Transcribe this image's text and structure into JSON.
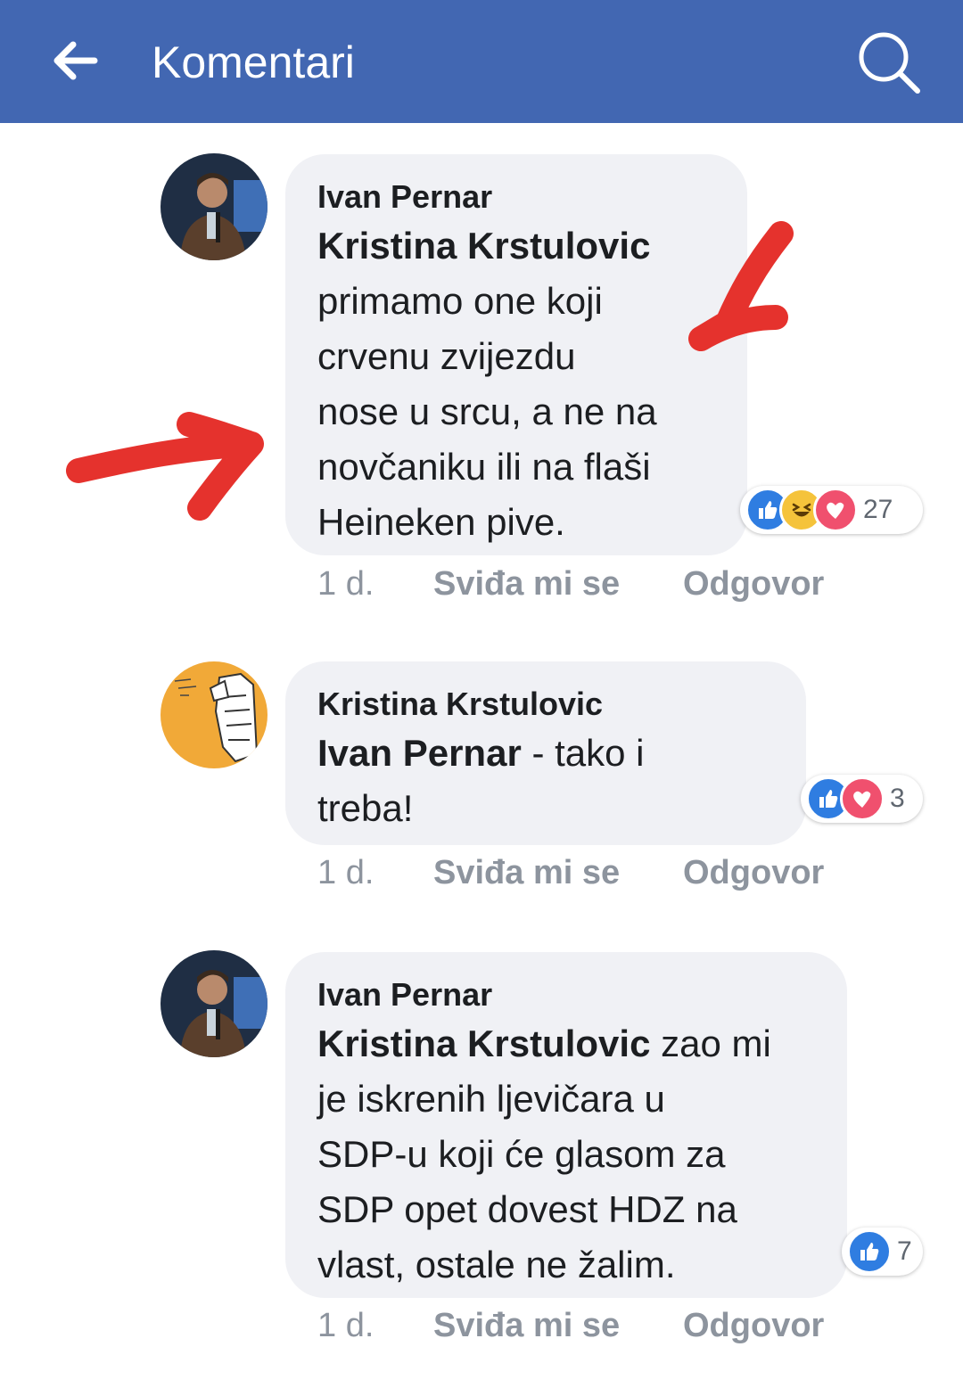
{
  "header": {
    "title": "Komentari",
    "color": "#4267b2"
  },
  "comments": [
    {
      "author": "Ivan Pernar",
      "lines": [
        [
          {
            "text": "Kristina Krstulovic",
            "bold": true
          }
        ],
        [
          {
            "text": "primamo one koji",
            "bold": false
          }
        ],
        [
          {
            "text": "crvenu zvijezdu",
            "bold": false
          }
        ],
        [
          {
            "text": "nose u srcu, a ne na",
            "bold": false
          }
        ],
        [
          {
            "text": "novčaniku ili na flaši",
            "bold": false
          }
        ],
        [
          {
            "text": "Heineken pive.",
            "bold": false
          }
        ]
      ],
      "time": "1 d.",
      "like_label": "Sviđa mi se",
      "reply_label": "Odgovor",
      "reaction_icons": [
        "like",
        "haha",
        "love"
      ],
      "reaction_count": "27"
    },
    {
      "author": "Kristina Krstulovic",
      "lines": [
        [
          {
            "text": "Ivan Pernar",
            "bold": true
          },
          {
            "text": " - tako i",
            "bold": false
          }
        ],
        [
          {
            "text": "treba!",
            "bold": false
          }
        ]
      ],
      "time": "1 d.",
      "like_label": "Sviđa mi se",
      "reply_label": "Odgovor",
      "reaction_icons": [
        "like",
        "love"
      ],
      "reaction_count": "3"
    },
    {
      "author": "Ivan Pernar",
      "lines": [
        [
          {
            "text": "Kristina Krstulovic",
            "bold": true
          },
          {
            "text": " zao mi",
            "bold": false
          }
        ],
        [
          {
            "text": "je iskrenih ljevičara u",
            "bold": false
          }
        ],
        [
          {
            "text": "SDP-u koji će glasom za",
            "bold": false
          }
        ],
        [
          {
            "text": "SDP opet dovest HDZ na",
            "bold": false
          }
        ],
        [
          {
            "text": "vlast, ostale ne žalim.",
            "bold": false
          }
        ]
      ],
      "time": "1 d.",
      "like_label": "Sviđa mi se",
      "reply_label": "Odgovor",
      "reaction_icons": [
        "like"
      ],
      "reaction_count": "7"
    }
  ],
  "annotation_color": "#e5322d"
}
